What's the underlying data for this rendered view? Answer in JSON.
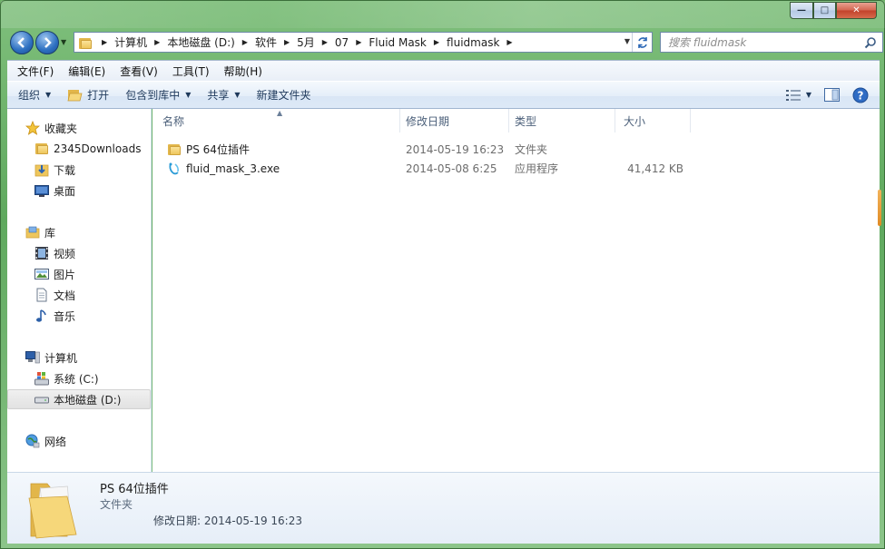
{
  "window": {
    "caption_buttons": {
      "minimize": "—",
      "maximize": "□",
      "close": "✕"
    }
  },
  "nav": {
    "breadcrumbs": [
      "计算机",
      "本地磁盘 (D:)",
      "软件",
      "5月",
      "07",
      "Fluid Mask",
      "fluidmask"
    ],
    "search_placeholder": "搜索 fluidmask"
  },
  "menubar": {
    "items": [
      "文件(F)",
      "编辑(E)",
      "查看(V)",
      "工具(T)",
      "帮助(H)"
    ]
  },
  "commandbar": {
    "organize": "组织",
    "open": "打开",
    "include_in_library": "包含到库中",
    "share": "共享",
    "new_folder": "新建文件夹"
  },
  "sidebar": {
    "favorites": {
      "label": "收藏夹",
      "items": [
        "2345Downloads",
        "下载",
        "桌面"
      ]
    },
    "libraries": {
      "label": "库",
      "items": [
        "视频",
        "图片",
        "文档",
        "音乐"
      ]
    },
    "computer": {
      "label": "计算机",
      "items": [
        "系统 (C:)",
        "本地磁盘 (D:)"
      ]
    },
    "network": {
      "label": "网络"
    }
  },
  "columns": {
    "name": "名称",
    "date": "修改日期",
    "type": "类型",
    "size": "大小"
  },
  "files": [
    {
      "name": "PS 64位插件",
      "date": "2014-05-19 16:23",
      "type": "文件夹",
      "size": "",
      "icon": "folder-icon"
    },
    {
      "name": "fluid_mask_3.exe",
      "date": "2014-05-08 6:25",
      "type": "应用程序",
      "size": "41,412 KB",
      "icon": "exe-icon"
    }
  ],
  "details": {
    "name": "PS 64位插件",
    "type": "文件夹",
    "date_line": "修改日期: 2014-05-19 16:23"
  }
}
